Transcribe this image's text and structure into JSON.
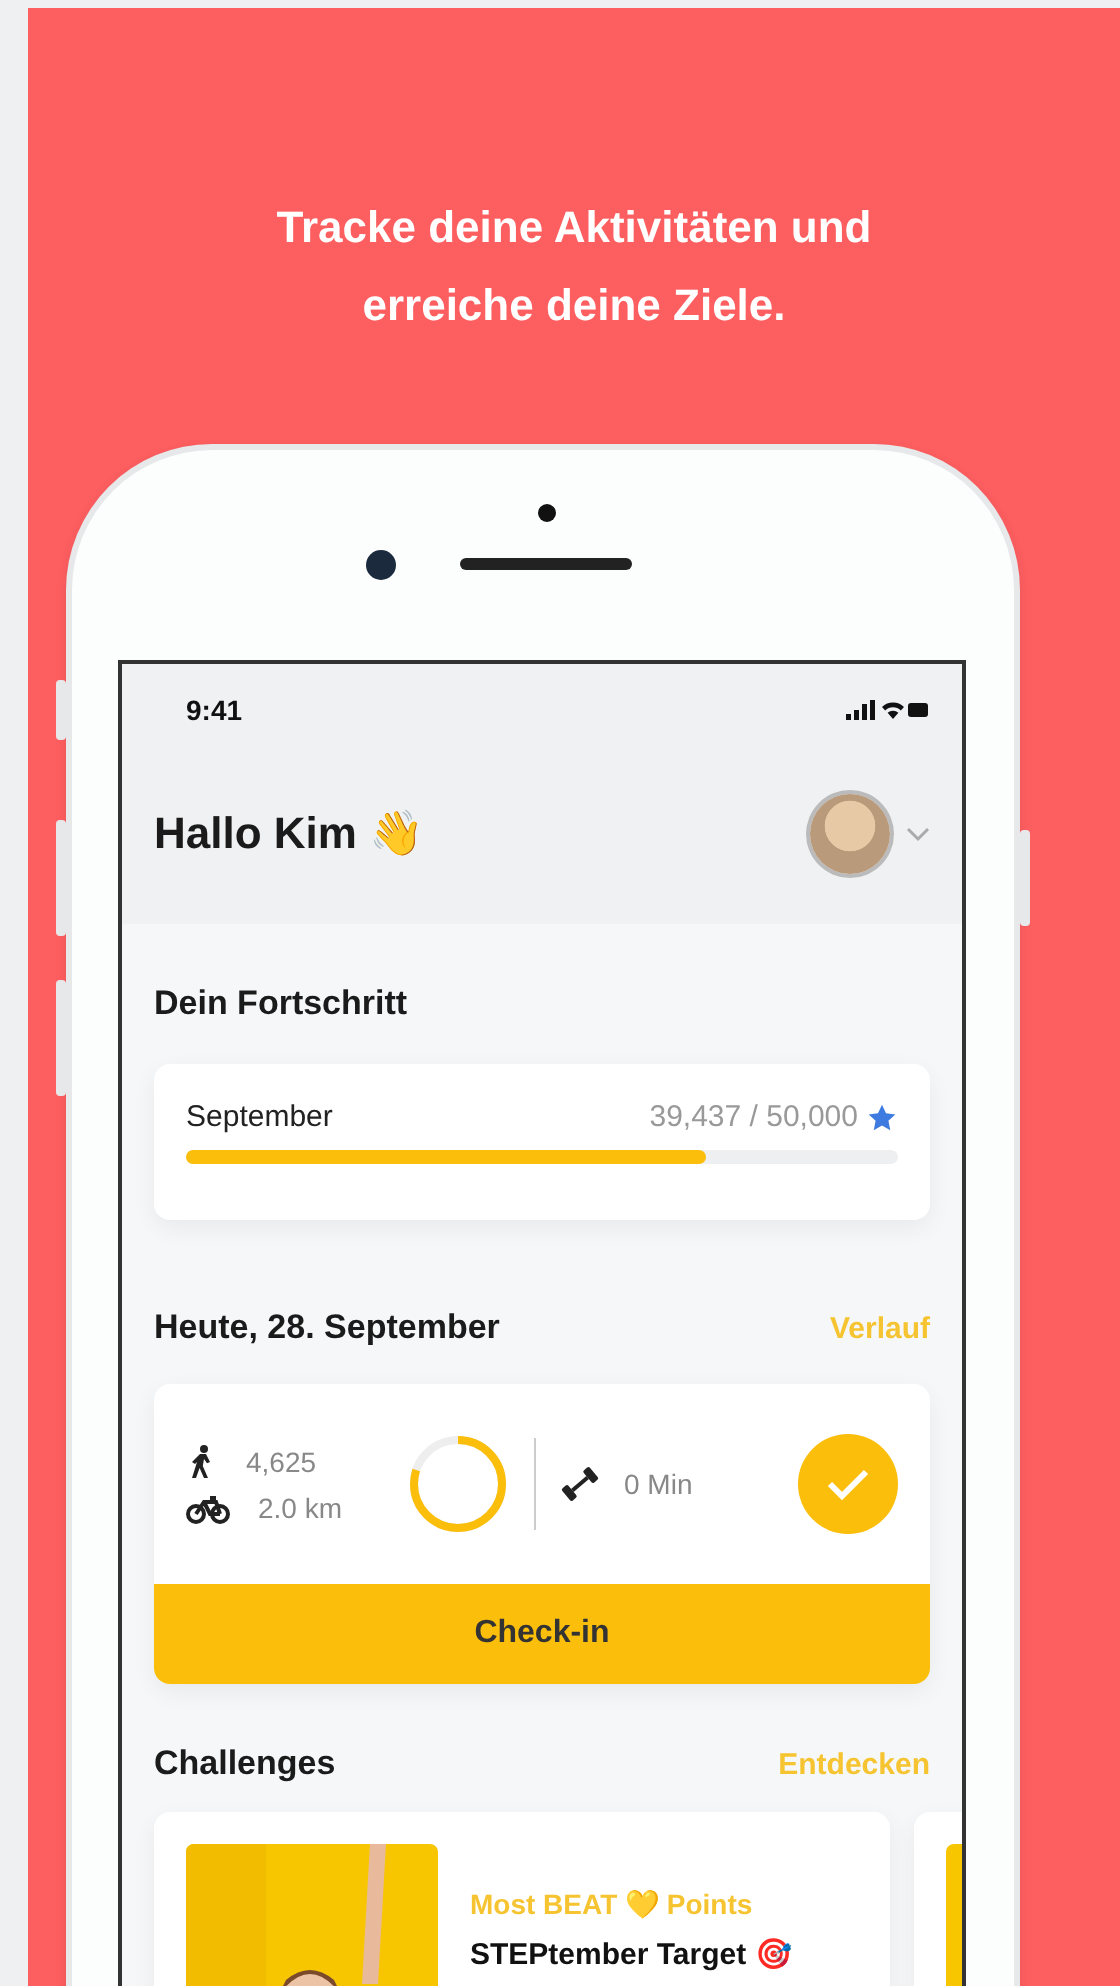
{
  "headline": "Tracke deine Aktivitäten und erreiche deine Ziele.",
  "status_bar": {
    "time": "9:41"
  },
  "header": {
    "greeting": "Hallo Kim 👋"
  },
  "progress": {
    "title": "Dein Fortschritt",
    "month": "September",
    "reading": "39,437 / 50,000",
    "level": 0.73
  },
  "today": {
    "title": "Heute, 28. September",
    "link": "Verlauf",
    "steps": "4,625",
    "distance": "2.0 km",
    "ring": {
      "level": 0.8
    },
    "workout": "0 Min",
    "done": true,
    "button": "Check-in"
  },
  "challenges": {
    "title": "Challenges",
    "link": "Entdecken",
    "cards": [
      {
        "kind": "picture",
        "tag": "Most BEAT 💛 Points",
        "name": "STEPtember Target 🎯"
      }
    ]
  }
}
